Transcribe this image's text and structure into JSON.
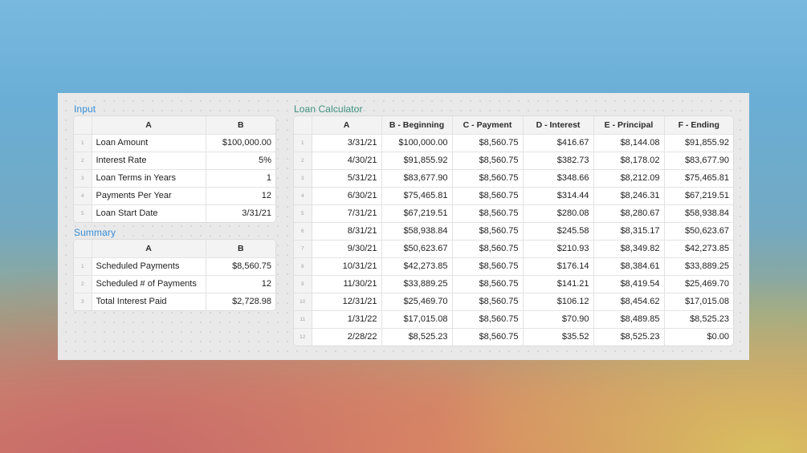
{
  "input": {
    "title": "Input",
    "columns": [
      "A",
      "B"
    ],
    "rows": [
      {
        "num": "1",
        "label": "Loan Amount",
        "value": "$100,000.00"
      },
      {
        "num": "2",
        "label": "Interest Rate",
        "value": "5%"
      },
      {
        "num": "3",
        "label": "Loan Terms in Years",
        "value": "1"
      },
      {
        "num": "4",
        "label": "Payments Per Year",
        "value": "12"
      },
      {
        "num": "5",
        "label": "Loan Start Date",
        "value": "3/31/21"
      }
    ]
  },
  "summary": {
    "title": "Summary",
    "columns": [
      "A",
      "B"
    ],
    "rows": [
      {
        "num": "1",
        "label": "Scheduled Payments",
        "value": "$8,560.75"
      },
      {
        "num": "2",
        "label": "Scheduled # of Payments",
        "value": "12"
      },
      {
        "num": "3",
        "label": "Total Interest Paid",
        "value": "$2,728.98"
      }
    ]
  },
  "calculator": {
    "title": "Loan Calculator",
    "columns": [
      "A",
      "B - Beginning",
      "C - Payment",
      "D - Interest",
      "E - Principal",
      "F - Ending"
    ],
    "rows": [
      {
        "num": "1",
        "cells": [
          "3/31/21",
          "$100,000.00",
          "$8,560.75",
          "$416.67",
          "$8,144.08",
          "$91,855.92"
        ]
      },
      {
        "num": "2",
        "cells": [
          "4/30/21",
          "$91,855.92",
          "$8,560.75",
          "$382.73",
          "$8,178.02",
          "$83,677.90"
        ]
      },
      {
        "num": "3",
        "cells": [
          "5/31/21",
          "$83,677.90",
          "$8,560.75",
          "$348.66",
          "$8,212.09",
          "$75,465.81"
        ]
      },
      {
        "num": "4",
        "cells": [
          "6/30/21",
          "$75,465.81",
          "$8,560.75",
          "$314.44",
          "$8,246.31",
          "$67,219.51"
        ]
      },
      {
        "num": "5",
        "cells": [
          "7/31/21",
          "$67,219.51",
          "$8,560.75",
          "$280.08",
          "$8,280.67",
          "$58,938.84"
        ]
      },
      {
        "num": "6",
        "cells": [
          "8/31/21",
          "$58,938.84",
          "$8,560.75",
          "$245.58",
          "$8,315.17",
          "$50,623.67"
        ]
      },
      {
        "num": "7",
        "cells": [
          "9/30/21",
          "$50,623.67",
          "$8,560.75",
          "$210.93",
          "$8,349.82",
          "$42,273.85"
        ]
      },
      {
        "num": "8",
        "cells": [
          "10/31/21",
          "$42,273.85",
          "$8,560.75",
          "$176.14",
          "$8,384.61",
          "$33,889.25"
        ]
      },
      {
        "num": "9",
        "cells": [
          "11/30/21",
          "$33,889.25",
          "$8,560.75",
          "$141.21",
          "$8,419.54",
          "$25,469.70"
        ]
      },
      {
        "num": "10",
        "cells": [
          "12/31/21",
          "$25,469.70",
          "$8,560.75",
          "$106.12",
          "$8,454.62",
          "$17,015.08"
        ]
      },
      {
        "num": "11",
        "cells": [
          "1/31/22",
          "$17,015.08",
          "$8,560.75",
          "$70.90",
          "$8,489.85",
          "$8,525.23"
        ]
      },
      {
        "num": "12",
        "cells": [
          "2/28/22",
          "$8,525.23",
          "$8,560.75",
          "$35.52",
          "$8,525.23",
          "$0.00"
        ]
      }
    ]
  }
}
